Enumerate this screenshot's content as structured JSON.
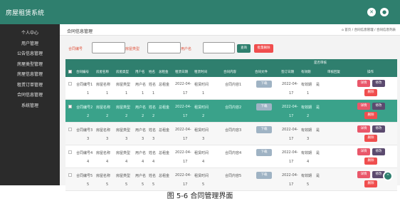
{
  "app": {
    "title": "房屋租赁系统"
  },
  "topbar": {
    "close_icon": "✕",
    "user_icon": "●"
  },
  "sidebar": {
    "items": [
      {
        "label": "个人中心"
      },
      {
        "label": "用户管理"
      },
      {
        "label": "公告信息管理"
      },
      {
        "label": "房屋类型管理"
      },
      {
        "label": "房屋信息管理"
      },
      {
        "label": "租赁订单管理"
      },
      {
        "label": "合同信息管理"
      },
      {
        "label": "系统管理"
      }
    ]
  },
  "page": {
    "title": "合同信息管理",
    "breadcrumb": "⌂ 首页 / 合同信息管理 / 合同信息列表"
  },
  "search": {
    "fields": [
      {
        "label": "合同编号",
        "value": ""
      },
      {
        "label": "房屋类型",
        "value": ""
      },
      {
        "label": "用户名",
        "value": ""
      }
    ],
    "search_label": "查询",
    "batch_delete_label": "批量删除"
  },
  "table": {
    "group_header": "是否审核",
    "headers": [
      "合同编号",
      "房屋名称",
      "房屋类型",
      "用户名",
      "姓名",
      "总租金",
      "租赁日期",
      "租赁时间",
      "合同内容",
      "合同文件",
      "签订日期",
      "有效期",
      "审核回复",
      "操作"
    ],
    "download_label": "下载",
    "view_label": "详情",
    "edit_label": "修改",
    "delete_label": "删除",
    "rows": [
      {
        "contract_no": "合同编号1",
        "house_name": "房屋名称",
        "house_type": "房屋类型",
        "username": "用户名",
        "name": "姓名",
        "total_rent": "总租金",
        "lease_date": "2022-04-",
        "lease_time": "租赁时间",
        "content": "合同内容1",
        "sign_date": "2022-04-",
        "valid": "有效期",
        "audit": "是",
        "n1": "1",
        "n2": "1",
        "n3": "1",
        "n4": "1",
        "n5": "1",
        "d1": "17",
        "d2": "1",
        "sd": "17",
        "v2": "1"
      },
      {
        "contract_no": "合同编号2",
        "house_name": "房屋名称",
        "house_type": "房屋类型",
        "username": "用户名",
        "name": "姓名",
        "total_rent": "总租金",
        "lease_date": "2022-04-",
        "lease_time": "租赁时间",
        "content": "合同内容2",
        "sign_date": "2022-04-",
        "valid": "有效期",
        "audit": "是",
        "n1": "2",
        "n2": "2",
        "n3": "2",
        "n4": "2",
        "n5": "2",
        "d1": "17",
        "d2": "2",
        "sd": "17",
        "v2": "2"
      },
      {
        "contract_no": "合同编号3",
        "house_name": "房屋名称",
        "house_type": "房屋类型",
        "username": "用户名",
        "name": "姓名",
        "total_rent": "总租金",
        "lease_date": "2022-04-",
        "lease_time": "租赁时间",
        "content": "合同内容3",
        "sign_date": "2022-04-",
        "valid": "有效期",
        "audit": "是",
        "n1": "3",
        "n2": "3",
        "n3": "3",
        "n4": "3",
        "n5": "3",
        "d1": "17",
        "d2": "3",
        "sd": "17",
        "v2": "3"
      },
      {
        "contract_no": "合同编号4",
        "house_name": "房屋名称",
        "house_type": "房屋类型",
        "username": "用户名",
        "name": "姓名",
        "total_rent": "总租金",
        "lease_date": "2022-04-",
        "lease_time": "租赁时间",
        "content": "合同内容4",
        "sign_date": "2022-04-",
        "valid": "有效期",
        "audit": "是",
        "n1": "4",
        "n2": "4",
        "n3": "4",
        "n4": "4",
        "n5": "4",
        "d1": "17",
        "d2": "4",
        "sd": "17",
        "v2": "4"
      },
      {
        "contract_no": "合同编号5",
        "house_name": "房屋名称",
        "house_type": "房屋类型",
        "username": "用户名",
        "name": "姓名",
        "total_rent": "总租金",
        "lease_date": "2022-04-",
        "lease_time": "租赁时间",
        "content": "合同内容5",
        "sign_date": "2022-04-",
        "valid": "有效期",
        "audit": "是",
        "n1": "5",
        "n2": "5",
        "n3": "5",
        "n4": "5",
        "n5": "5",
        "d1": "17",
        "d2": "5",
        "sd": "17",
        "v2": "5"
      }
    ]
  },
  "scroll_top_icon": "⌃",
  "caption": "图 5-6 合同管理界面",
  "colors": {
    "primary": "#2f7f6e",
    "selected_row": "#3aa28a",
    "search_button": "#2f7f6e",
    "delete_button": "#f04e4e",
    "label": "#e0533d"
  }
}
